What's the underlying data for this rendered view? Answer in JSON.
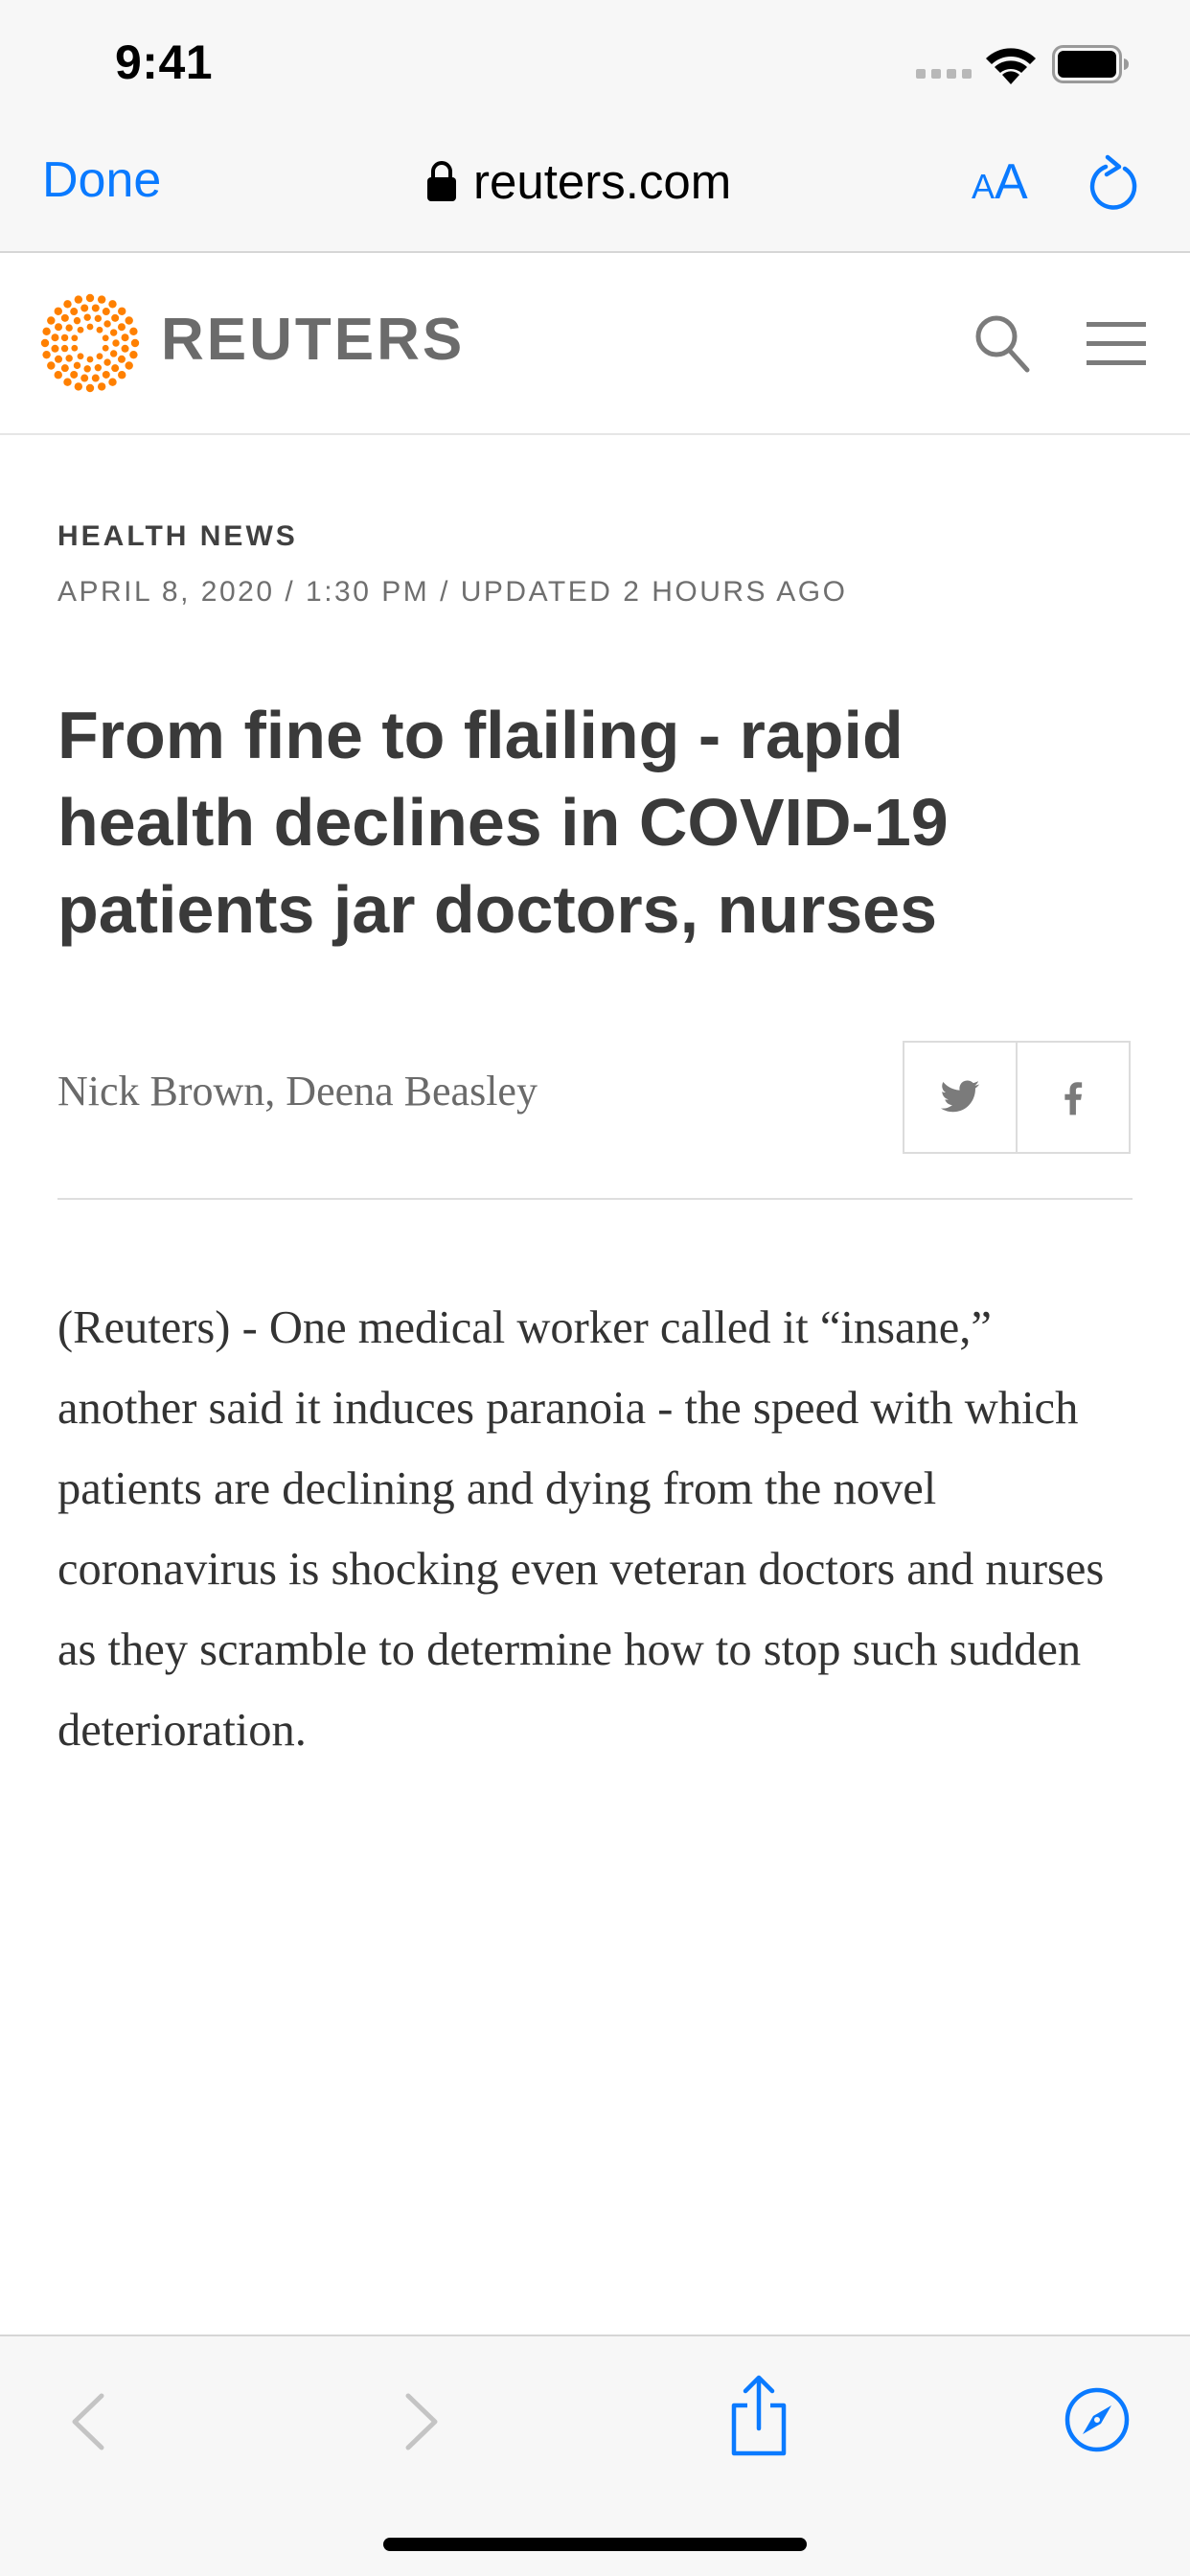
{
  "status_bar": {
    "time": "9:41"
  },
  "browser": {
    "done_label": "Done",
    "url": "reuters.com",
    "text_size_small": "A",
    "text_size_large": "A",
    "accent_color": "#0a7aff"
  },
  "site": {
    "logo_text": "REUTERS",
    "brand_color": "#ff8000"
  },
  "article": {
    "section": "HEALTH NEWS",
    "dateline": "APRIL 8, 2020 / 1:30 PM / UPDATED 2 HOURS AGO",
    "headline": "From fine to flailing - rapid health declines in COVID-19 patients jar doctors, nurses",
    "byline": "Nick Brown, Deena Beasley",
    "body": "(Reuters) - One medical worker called it “insane,” another said it induces paranoia - the speed with which patients are declining and dying from the novel coronavirus is shocking even veteran doctors and nurses as they scramble to determine how to stop such sudden deterioration."
  },
  "icons": {
    "share_buttons": [
      "twitter-icon",
      "facebook-icon"
    ],
    "toolbar": [
      "back-icon",
      "forward-icon",
      "share-icon",
      "compass-icon"
    ]
  }
}
